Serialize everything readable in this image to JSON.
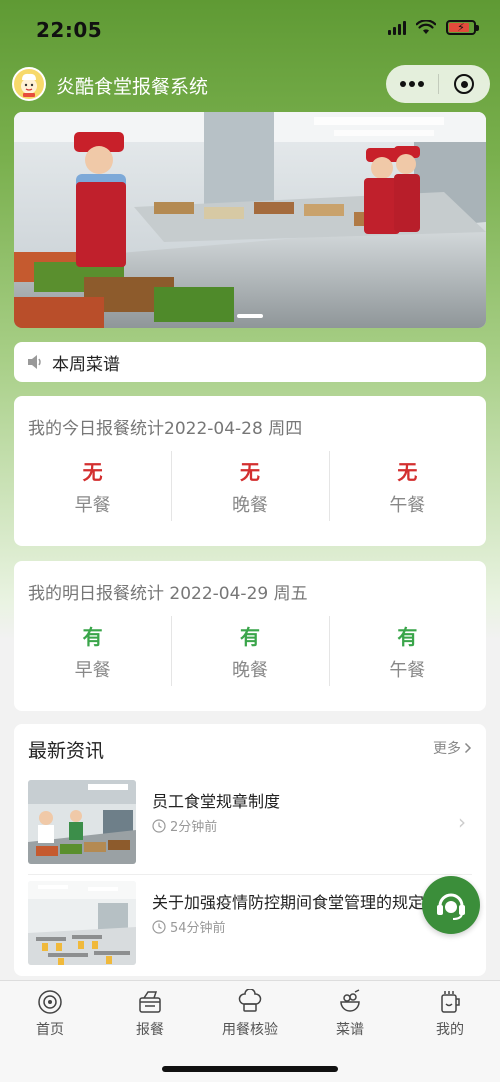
{
  "status_bar": {
    "time": "22:05"
  },
  "header": {
    "title": "炎酷食堂报餐系统"
  },
  "notice": {
    "label": "本周菜谱"
  },
  "today_stats": {
    "title": "我的今日报餐统计2022-04-28 周四",
    "items": [
      {
        "value": "无",
        "label": "早餐"
      },
      {
        "value": "无",
        "label": "晚餐"
      },
      {
        "value": "无",
        "label": "午餐"
      }
    ]
  },
  "tomorrow_stats": {
    "title": "我的明日报餐统计 2022-04-29 周五",
    "items": [
      {
        "value": "有",
        "label": "早餐"
      },
      {
        "value": "有",
        "label": "晚餐"
      },
      {
        "value": "有",
        "label": "午餐"
      }
    ]
  },
  "news": {
    "title": "最新资讯",
    "more": "更多",
    "items": [
      {
        "title": "员工食堂规章制度",
        "time": "2分钟前"
      },
      {
        "title": "关于加强疫情防控期间食堂管理的规定",
        "time": "54分钟前"
      }
    ]
  },
  "tabbar": {
    "items": [
      {
        "label": "首页",
        "icon": "home-icon"
      },
      {
        "label": "报餐",
        "icon": "meal-order-icon"
      },
      {
        "label": "用餐核验",
        "icon": "chef-hat-icon"
      },
      {
        "label": "菜谱",
        "icon": "menu-icon"
      },
      {
        "label": "我的",
        "icon": "profile-icon"
      }
    ]
  },
  "colors": {
    "brand_green": "#5f9a34",
    "no_red": "#d32f2f",
    "yes_green": "#3aa54a",
    "battery_red": "#e14b3b"
  }
}
